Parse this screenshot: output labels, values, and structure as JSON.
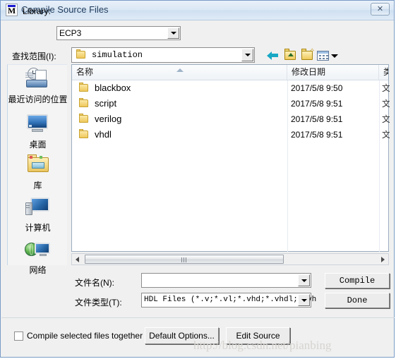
{
  "window": {
    "title": "Compile Source Files",
    "logo_letter": "M",
    "close_label": "✕"
  },
  "library": {
    "label": "Library:",
    "value": "ECP3"
  },
  "lookin": {
    "label": "查找范围(I):",
    "value": "simulation",
    "toolbar": [
      {
        "name": "back-icon",
        "tooltip": "后退"
      },
      {
        "name": "up-folder-icon",
        "tooltip": "向上一级"
      },
      {
        "name": "new-folder-icon",
        "tooltip": "新建文件夹"
      },
      {
        "name": "views-icon",
        "tooltip": "视图"
      }
    ]
  },
  "places": [
    {
      "label": "最近访问的位置",
      "icon": "recent-places-icon"
    },
    {
      "label": "桌面",
      "icon": "desktop-icon"
    },
    {
      "label": "库",
      "icon": "library-icon"
    },
    {
      "label": "计算机",
      "icon": "computer-icon"
    },
    {
      "label": "网络",
      "icon": "network-icon"
    }
  ],
  "filelist": {
    "columns": [
      "名称",
      "修改日期",
      "类"
    ],
    "rows": [
      {
        "name": "blackbox",
        "date": "2017/5/8 9:50",
        "type": "文"
      },
      {
        "name": "script",
        "date": "2017/5/8 9:51",
        "type": "文"
      },
      {
        "name": "verilog",
        "date": "2017/5/8 9:51",
        "type": "文"
      },
      {
        "name": "vhdl",
        "date": "2017/5/8 9:51",
        "type": "文"
      }
    ]
  },
  "filename": {
    "label": "文件名(N):",
    "value": "",
    "placeholder": ""
  },
  "filetype": {
    "label": "文件类型(T):",
    "value": "HDL Files (*.v;*.vl;*.vhd;*.vhdl;*.vh"
  },
  "buttons": {
    "compile": "Compile",
    "done": "Done",
    "default_options": "Default Options...",
    "edit_source": "Edit Source"
  },
  "checkbox": {
    "label": "Compile selected files together",
    "checked": false
  },
  "watermark": "http://blog.csdn.net/pianbing"
}
